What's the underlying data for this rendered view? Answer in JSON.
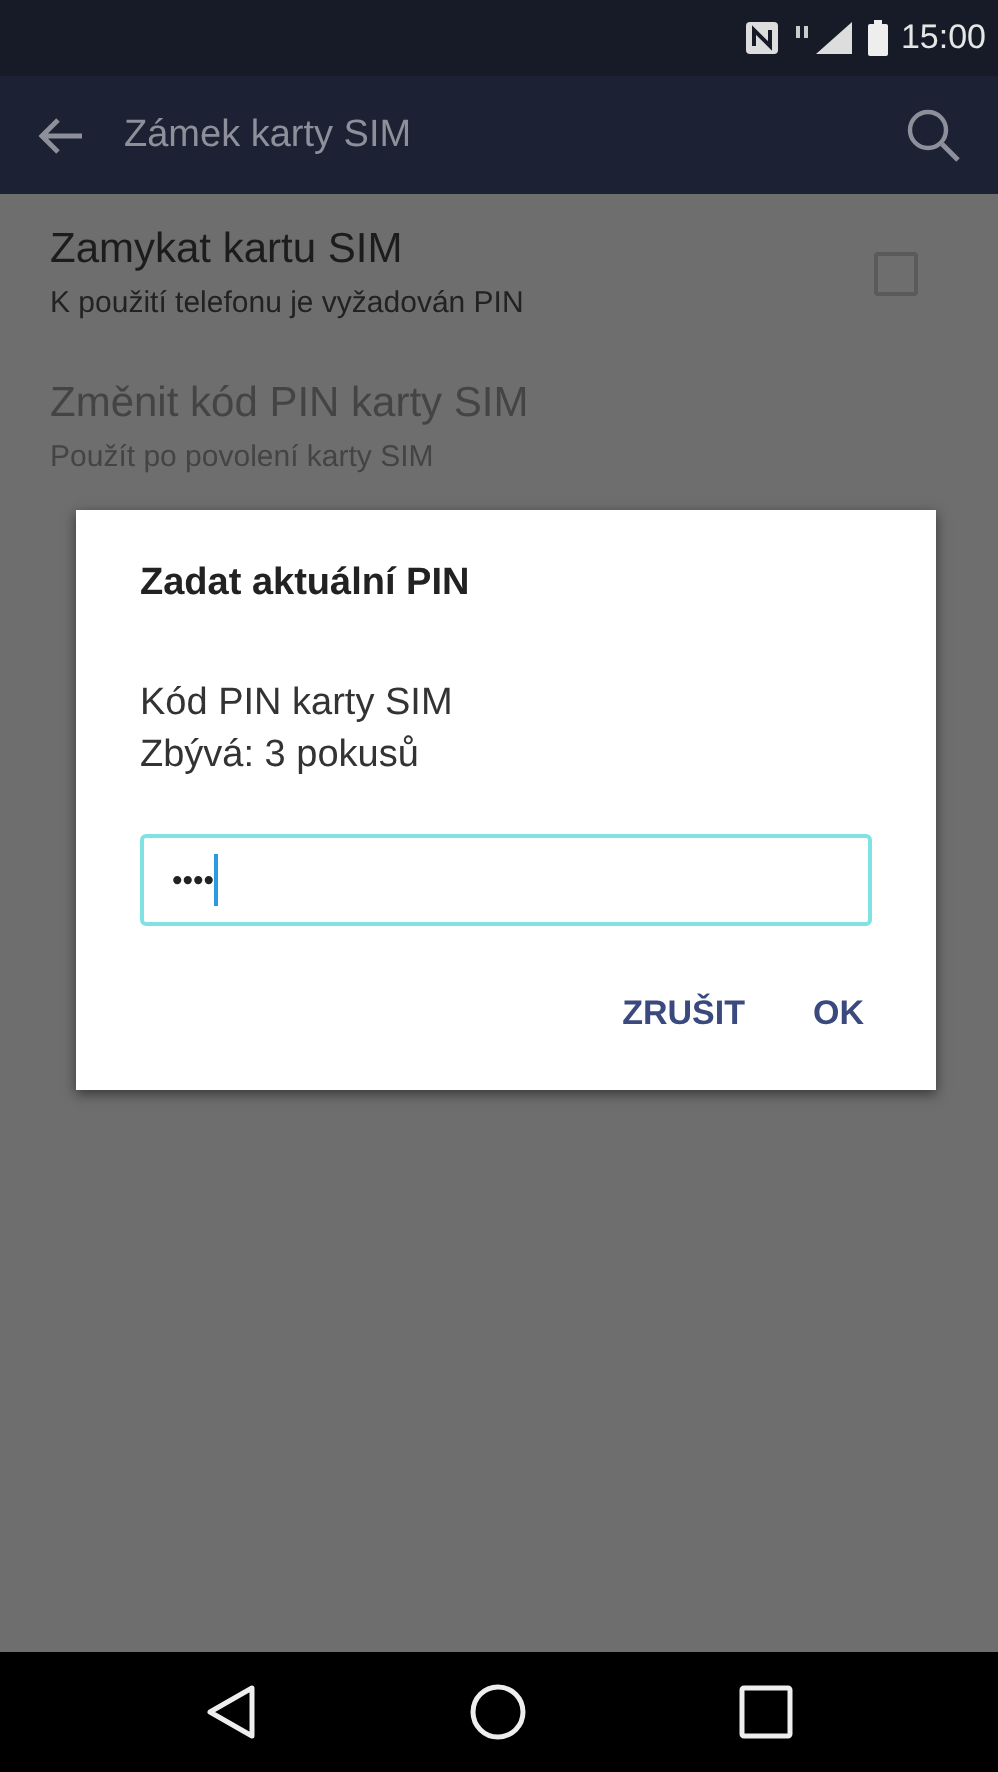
{
  "status_bar": {
    "time": "15:00"
  },
  "toolbar": {
    "title": "Zámek karty SIM"
  },
  "settings": [
    {
      "title": "Zamykat kartu SIM",
      "subtitle": "K použití telefonu je vyžadován PIN",
      "checked": false,
      "disabled": false,
      "kind": "checkbox"
    },
    {
      "title": "Změnit kód PIN karty SIM",
      "subtitle": "Použít po povolení karty SIM",
      "disabled": true,
      "kind": "plain"
    }
  ],
  "dialog": {
    "title": "Zadat aktuální PIN",
    "message_lines": [
      "Kód PIN karty SIM",
      "Zbývá: 3 pokusů"
    ],
    "pin_value": "••••",
    "buttons": [
      "ZRUŠIT",
      "OK"
    ]
  }
}
